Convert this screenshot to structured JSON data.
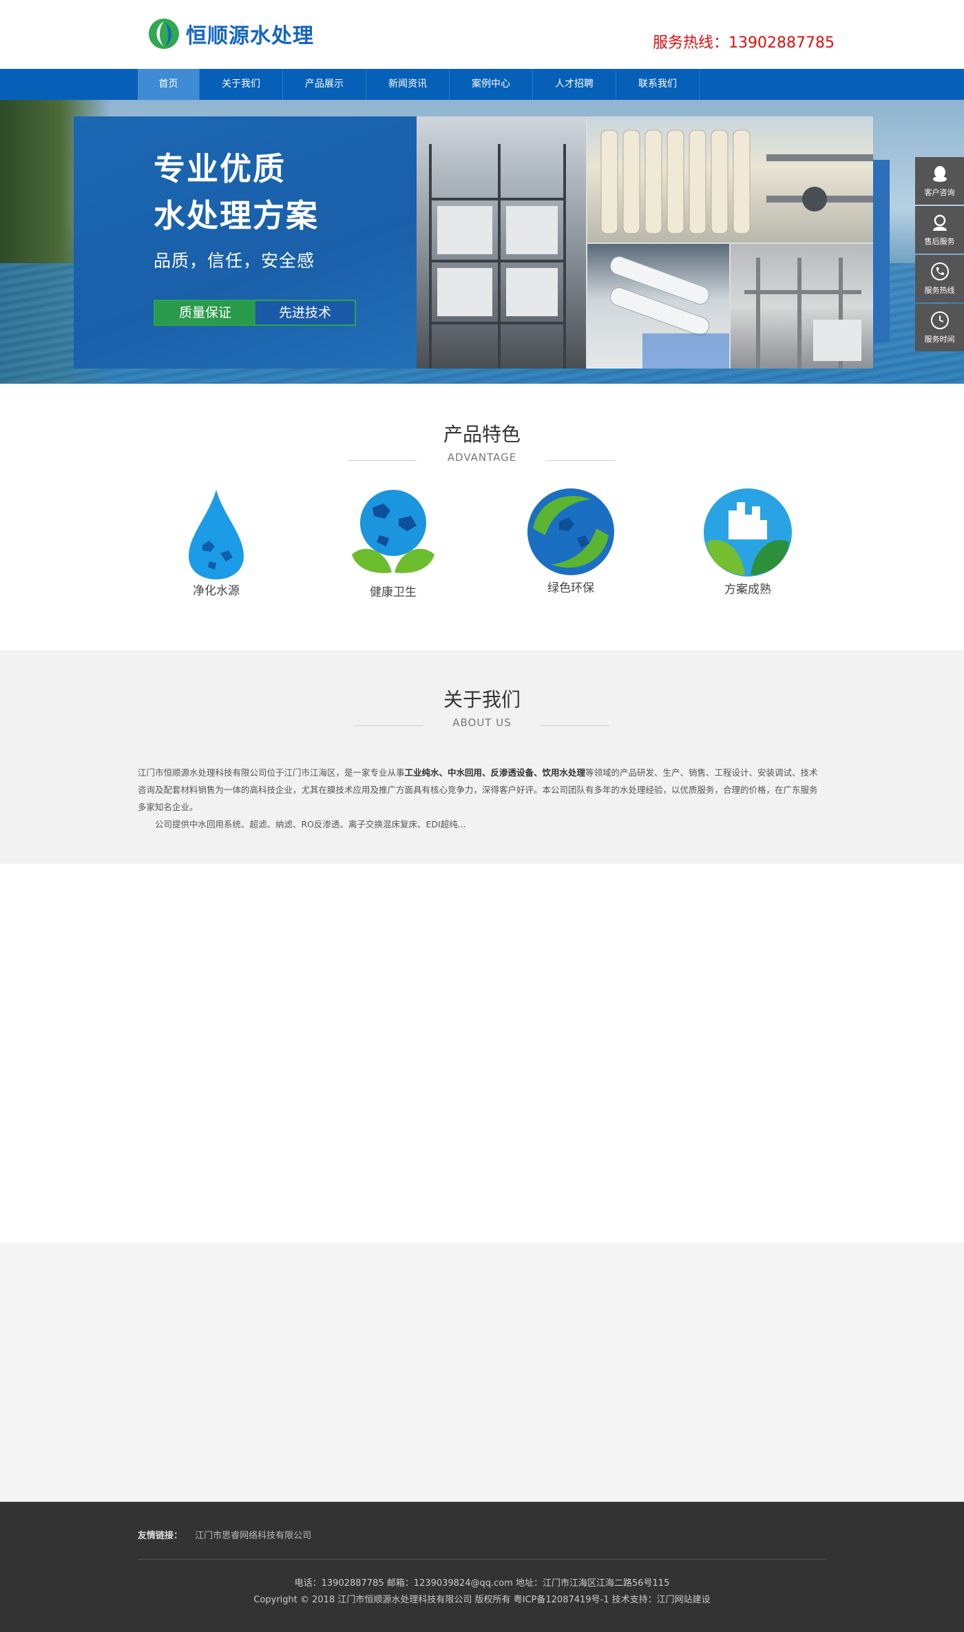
{
  "header": {
    "logo_text": "恒顺源水处理",
    "hotline": "服务热线：13902887785"
  },
  "nav": {
    "items": [
      "首页",
      "关于我们",
      "产品展示",
      "新闻资讯",
      "案例中心",
      "人才招聘",
      "联系我们"
    ]
  },
  "banner": {
    "headline_1": "专业优质",
    "headline_2": "水处理方案",
    "subline": "品质，信任，安全感",
    "btn_left": "质量保证",
    "btn_right": "先进技术"
  },
  "float_service": {
    "items": [
      "客户咨询",
      "售后服务",
      "服务热线",
      "服务时间"
    ]
  },
  "features": {
    "title": "产品特色",
    "subtitle": "ADVANTAGE",
    "items": [
      "净化水源",
      "健康卫生",
      "绿色环保",
      "方案成熟"
    ]
  },
  "about": {
    "title": "关于我们",
    "subtitle": "ABOUT US",
    "p1_a": "江门市恒顺源水处理科技有限公司位于江门市江海区，是一家专业从事",
    "p1_bold": "工业纯水、中水回用、反渗透设备、饮用水处理",
    "p1_b": "等领域的产品研发、生产、销售、工程设计、安装调试、技术咨询及配套材料销售为一体的高科技企业，尤其在膜技术应用及推广方面具有核心竞争力，深得客户好评。本公司团队有多年的水处理经验，以优质服务，合理的价格，在广东服务多家知名企业。",
    "p2": "公司提供中水回用系统、超滤、纳滤、RO反渗透、离子交换混床复床、EDI超纯..."
  },
  "footer": {
    "links_label": "友情链接：",
    "link_1": "江门市思睿网络科技有限公司",
    "contact": "电话：13902887785    邮箱：1239039824@qq.com    地址：江门市江海区江海二路56号115",
    "copyright": "Copyright © 2018 江门市恒顺源水处理科技有限公司 版权所有 粤ICP备12087419号-1    技术支持：江门网站建设"
  },
  "colors": {
    "nav_blue": "#0660b8",
    "hotline_red": "#e10e0e",
    "footer_bg": "#333333",
    "about_bg": "#f2f2f2"
  }
}
